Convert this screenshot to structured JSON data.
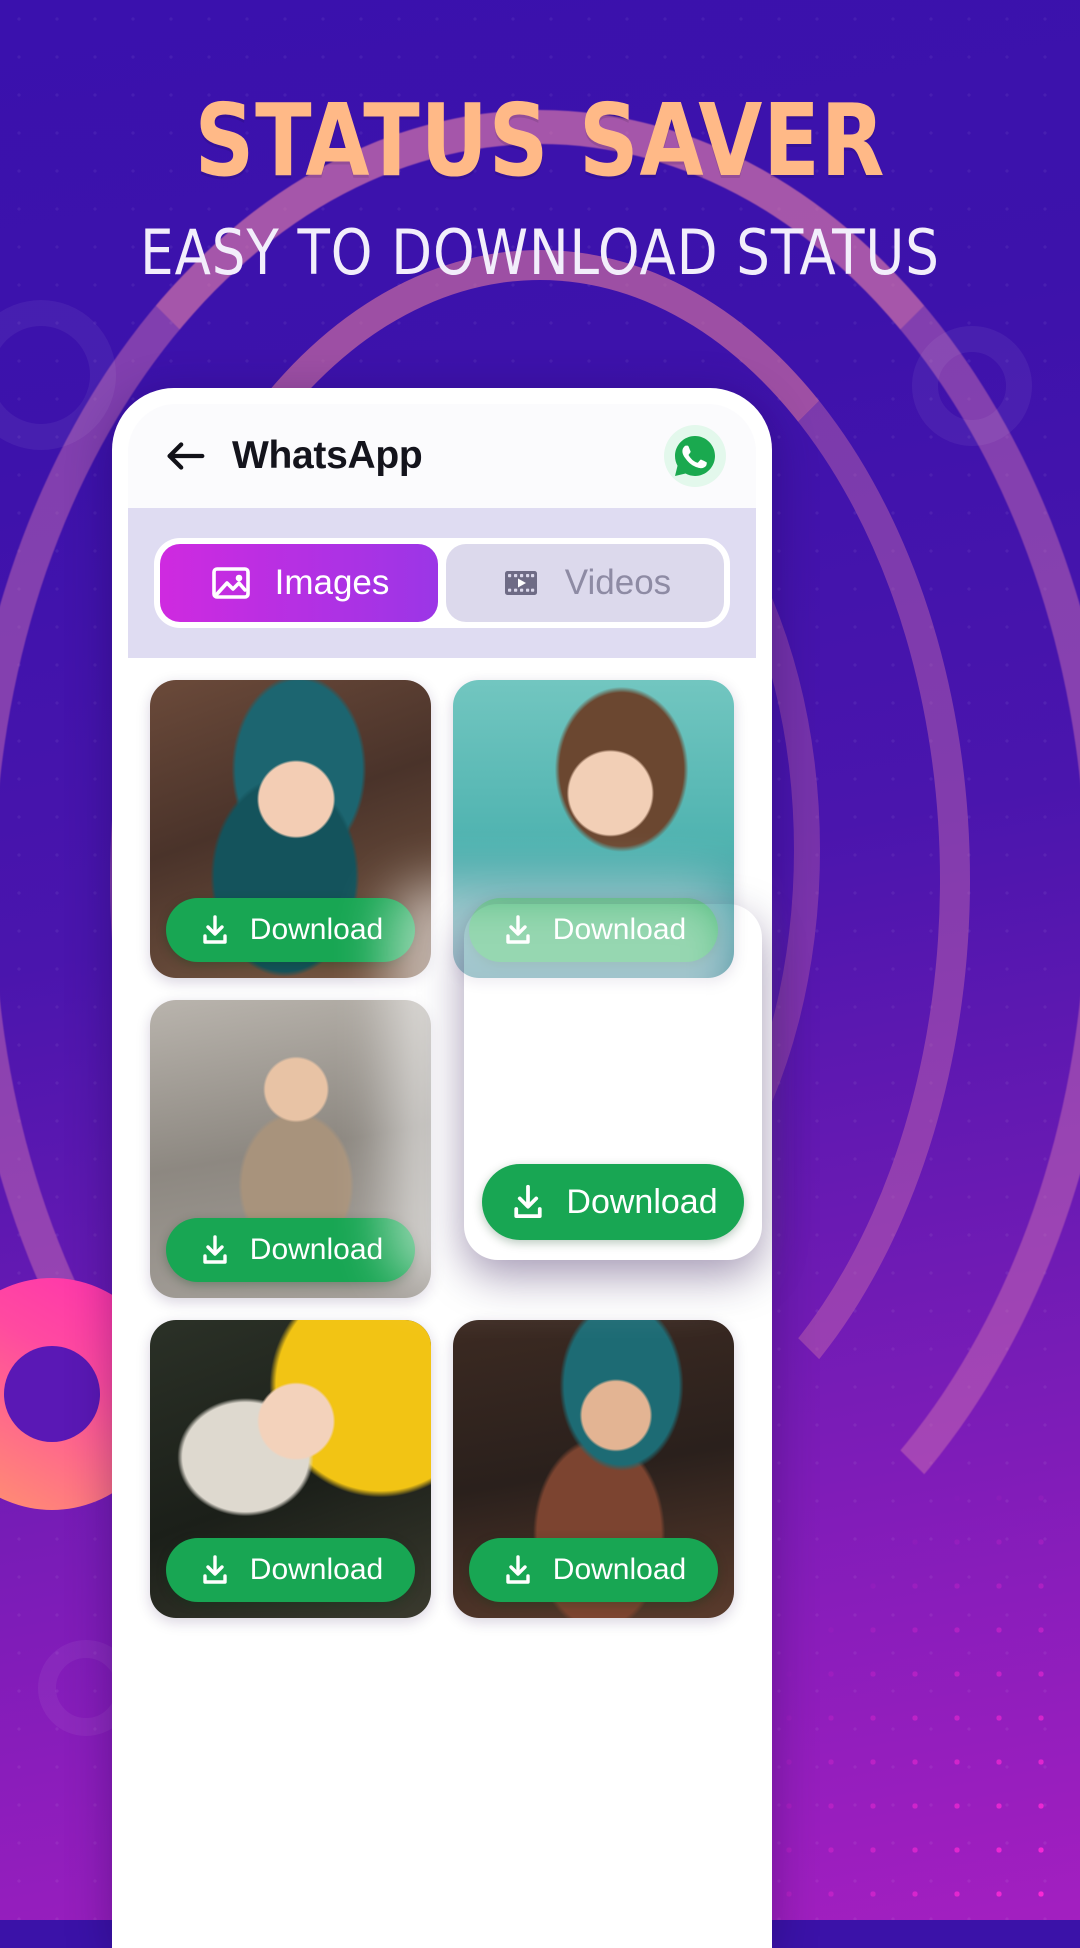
{
  "promo": {
    "title": "STATUS SAVER",
    "subtitle": "EASY TO DOWNLOAD STATUS",
    "title_color": "#ffb987",
    "subtitle_color": "#f2eefb",
    "background_color": "#3b12a8"
  },
  "app": {
    "bar": {
      "back_icon": "back-arrow-icon",
      "title": "WhatsApp",
      "badge_icon": "whatsapp-icon",
      "badge_color": "#18a653"
    },
    "tabs": [
      {
        "label": "Images",
        "icon": "image-icon",
        "active": true,
        "accent": "#cf2ae0"
      },
      {
        "label": "Videos",
        "icon": "film-icon",
        "active": false,
        "accent": "#8e8ba4"
      }
    ],
    "download_label": "Download",
    "download_icon": "download-icon",
    "download_color": "#18a653",
    "gallery": [
      {
        "id": "status-1",
        "caption": "Download",
        "art": "p1"
      },
      {
        "id": "status-2",
        "caption": "Download",
        "art": "p2"
      },
      {
        "id": "status-3",
        "caption": "Download",
        "art": "p3"
      },
      {
        "id": "status-4",
        "caption": "Download",
        "art": "p5"
      },
      {
        "id": "status-5",
        "caption": "Download",
        "art": "p6"
      }
    ],
    "featured": {
      "id": "status-featured",
      "caption": "Download",
      "art": "p4"
    }
  }
}
